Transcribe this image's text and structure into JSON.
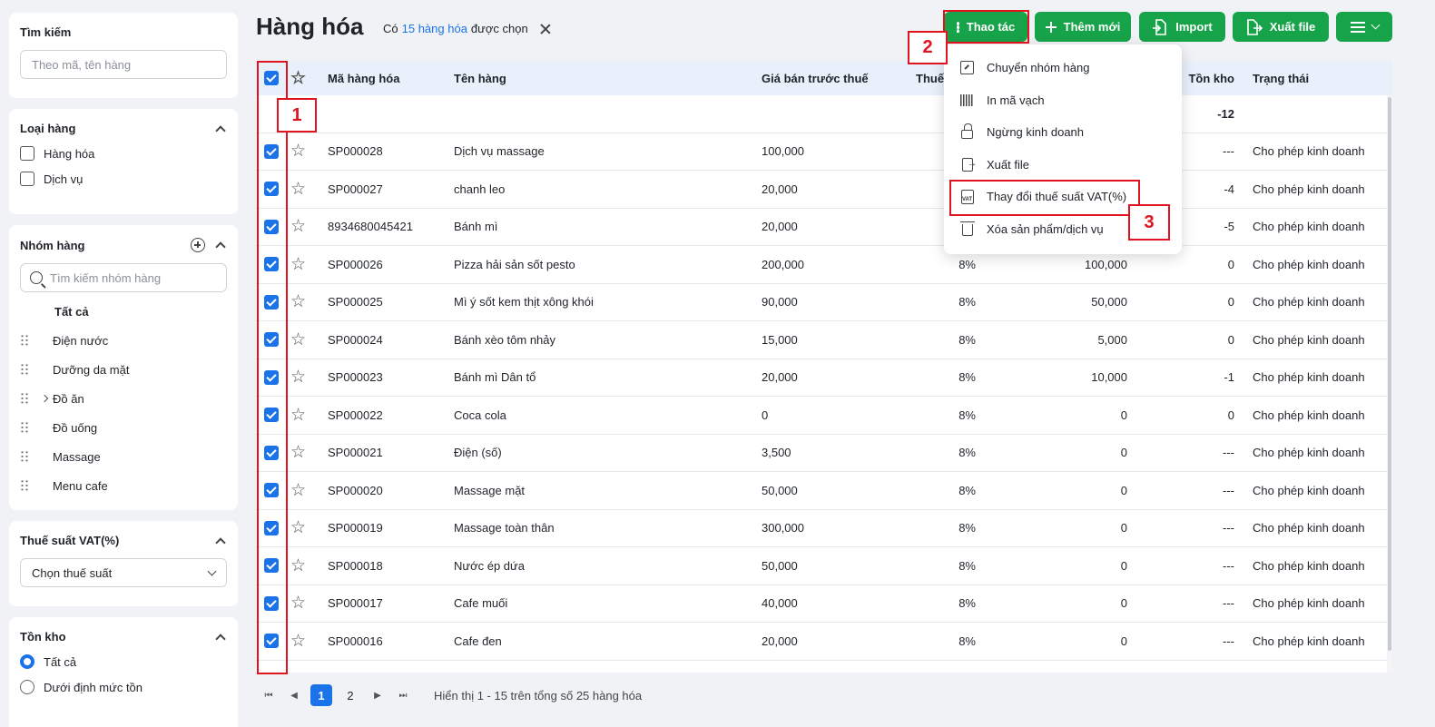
{
  "sidebar": {
    "search": {
      "title": "Tìm kiếm",
      "placeholder": "Theo mã, tên hàng"
    },
    "type": {
      "title": "Loại hàng",
      "options": [
        "Hàng hóa",
        "Dịch vụ"
      ]
    },
    "groups": {
      "title": "Nhóm hàng",
      "search_placeholder": "Tìm kiếm nhóm hàng",
      "all_label": "Tất cả",
      "items": [
        "Điện nước",
        "Dưỡng da mặt",
        "Đồ ăn",
        "Đồ uống",
        "Massage",
        "Menu cafe"
      ]
    },
    "vat": {
      "title": "Thuế suất VAT(%)",
      "select_value": "Chọn thuế suất"
    },
    "stock": {
      "title": "Tồn kho",
      "options": [
        "Tất cả",
        "Dưới định mức tồn"
      ]
    }
  },
  "header": {
    "title": "Hàng hóa",
    "selection_prefix": "Có",
    "selection_link": "15 hàng hóa",
    "selection_suffix": "được chọn",
    "buttons": {
      "actions": "Thao tác",
      "add": "Thêm mới",
      "import": "Import",
      "export": "Xuất file"
    }
  },
  "table": {
    "columns": {
      "code": "Mã hàng hóa",
      "name": "Tên hàng",
      "price": "Giá bán trước thuế",
      "vat": "Thuế",
      "stock": "Tồn kho",
      "status": "Trạng thái"
    },
    "summary": {
      "stock": "-12"
    },
    "rows": [
      {
        "code": "SP000028",
        "name": "Dịch vụ massage",
        "price": "100,000",
        "vat": "",
        "cost": "",
        "stock": "---",
        "status": "Cho phép kinh doanh"
      },
      {
        "code": "SP000027",
        "name": "chanh leo",
        "price": "20,000",
        "vat": "",
        "cost": "",
        "stock": "-4",
        "status": "Cho phép kinh doanh"
      },
      {
        "code": "8934680045421",
        "name": "Bánh mì",
        "price": "20,000",
        "vat": "",
        "cost": "",
        "stock": "-5",
        "status": "Cho phép kinh doanh"
      },
      {
        "code": "SP000026",
        "name": "Pizza hải sản sốt pesto",
        "price": "200,000",
        "vat": "8%",
        "cost": "100,000",
        "stock": "0",
        "status": "Cho phép kinh doanh"
      },
      {
        "code": "SP000025",
        "name": "Mì ý sốt kem thịt xông khói",
        "price": "90,000",
        "vat": "8%",
        "cost": "50,000",
        "stock": "0",
        "status": "Cho phép kinh doanh"
      },
      {
        "code": "SP000024",
        "name": "Bánh xèo tôm nhảy",
        "price": "15,000",
        "vat": "8%",
        "cost": "5,000",
        "stock": "0",
        "status": "Cho phép kinh doanh"
      },
      {
        "code": "SP000023",
        "name": "Bánh mì Dân tổ",
        "price": "20,000",
        "vat": "8%",
        "cost": "10,000",
        "stock": "-1",
        "status": "Cho phép kinh doanh"
      },
      {
        "code": "SP000022",
        "name": "Coca cola",
        "price": "0",
        "vat": "8%",
        "cost": "0",
        "stock": "0",
        "status": "Cho phép kinh doanh"
      },
      {
        "code": "SP000021",
        "name": "Điện (số)",
        "price": "3,500",
        "vat": "8%",
        "cost": "0",
        "stock": "---",
        "status": "Cho phép kinh doanh"
      },
      {
        "code": "SP000020",
        "name": "Massage mặt",
        "price": "50,000",
        "vat": "8%",
        "cost": "0",
        "stock": "---",
        "status": "Cho phép kinh doanh"
      },
      {
        "code": "SP000019",
        "name": "Massage toàn thân",
        "price": "300,000",
        "vat": "8%",
        "cost": "0",
        "stock": "---",
        "status": "Cho phép kinh doanh"
      },
      {
        "code": "SP000018",
        "name": "Nước ép dứa",
        "price": "50,000",
        "vat": "8%",
        "cost": "0",
        "stock": "---",
        "status": "Cho phép kinh doanh"
      },
      {
        "code": "SP000017",
        "name": "Cafe muối",
        "price": "40,000",
        "vat": "8%",
        "cost": "0",
        "stock": "---",
        "status": "Cho phép kinh doanh"
      },
      {
        "code": "SP000016",
        "name": "Cafe đen",
        "price": "20,000",
        "vat": "8%",
        "cost": "0",
        "stock": "---",
        "status": "Cho phép kinh doanh"
      }
    ]
  },
  "pager": {
    "pages": [
      "1",
      "2"
    ],
    "summary": "Hiển thị 1 - 15 trên tổng số 25 hàng hóa"
  },
  "menu": {
    "items": [
      {
        "label": "Chuyển nhóm hàng",
        "icon": "move-group-icon"
      },
      {
        "label": "In mã vạch",
        "icon": "barcode-icon"
      },
      {
        "label": "Ngừng kinh doanh",
        "icon": "lock-icon"
      },
      {
        "label": "Xuất file",
        "icon": "export-file-icon"
      },
      {
        "label": "Thay đổi thuế suất VAT(%)",
        "icon": "vat-file-icon"
      },
      {
        "label": "Xóa sản phẩm/dịch vụ",
        "icon": "trash-icon"
      }
    ]
  },
  "annotations": [
    "1",
    "2",
    "3"
  ],
  "colors": {
    "primary_green": "#17a34a",
    "accent_blue": "#1a73e8",
    "annotation_red": "#e0141e"
  }
}
